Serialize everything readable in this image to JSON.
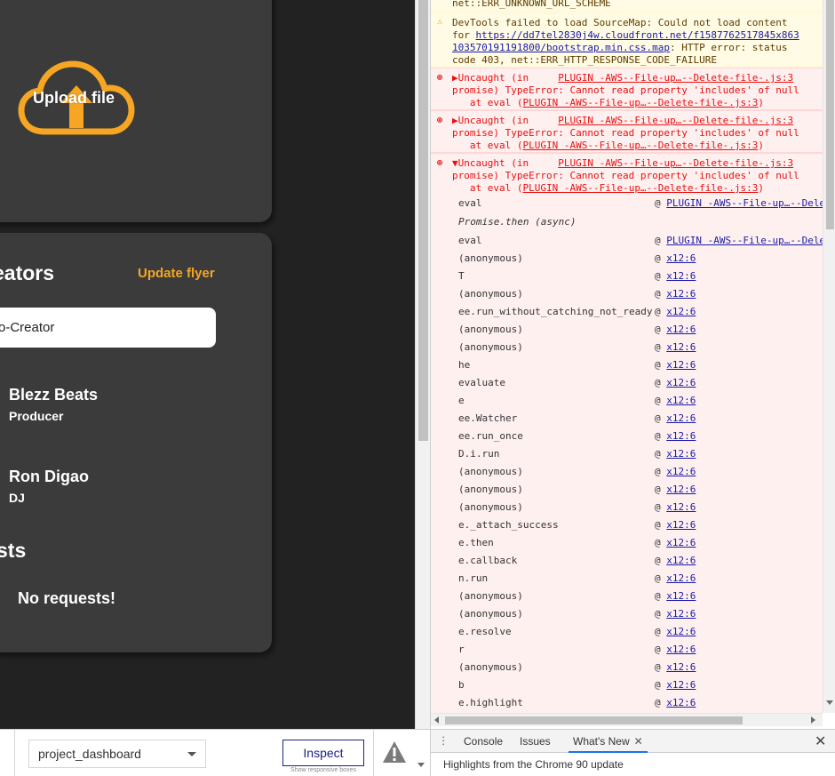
{
  "app": {
    "upload_label": "Upload file",
    "creators_title": "eators",
    "update_flyer": "Update flyer",
    "creator_input_value": "o-Creator",
    "people": [
      {
        "name": "Blezz Beats",
        "role": "Producer"
      },
      {
        "name": "Ron Digao",
        "role": "DJ"
      }
    ],
    "requests_title": "sts",
    "no_requests": "No requests!",
    "colors": {
      "accent": "#f6a623",
      "card": "#3b3b3b",
      "bg": "#222222"
    }
  },
  "device_toolbar": {
    "project_value": "project_dashboard",
    "inspect_label": "Inspect",
    "inspect_sub": "Show responsive boxes"
  },
  "console": {
    "top_line": "net::ERR_UNKNOWN_URL_SCHEME",
    "warning": {
      "line1": "DevTools failed to load SourceMap: Could not load content",
      "line2_prefix": "for ",
      "line2_link": "https://dd7tel2830j4w.cloudfront.net/f1587762517845x863",
      "line3_link": "103570191191800/bootstrap.min.css.map",
      "line3_suffix": ": HTTP error: status",
      "line4": "code 403, net::ERR_HTTP_RESPONSE_CODE_FAILURE"
    },
    "errors": [
      {
        "head": "Uncaught (in",
        "src": "PLUGIN -AWS--File-up…--Delete-file-.js:3",
        "line2": "promise) TypeError: Cannot read property 'includes' of null",
        "line3_prefix": "   at eval (",
        "line3_link": "PLUGIN -AWS--File-up…--Delete-file-.js:3",
        "line3_suffix": ")",
        "arrow": "▶"
      },
      {
        "head": "Uncaught (in",
        "src": "PLUGIN -AWS--File-up…--Delete-file-.js:3",
        "line2": "promise) TypeError: Cannot read property 'includes' of null",
        "line3_prefix": "   at eval (",
        "line3_link": "PLUGIN -AWS--File-up…--Delete-file-.js:3",
        "line3_suffix": ")",
        "arrow": "▶"
      },
      {
        "head": "Uncaught (in",
        "src": "PLUGIN -AWS--File-up…--Delete-file-.js:3",
        "line2": "promise) TypeError: Cannot read property 'includes' of null",
        "line3_prefix": "   at eval (",
        "line3_link": "PLUGIN -AWS--File-up…--Delete-file-.js:3",
        "line3_suffix": ")",
        "arrow": "▼"
      }
    ],
    "stack": [
      {
        "fn": "eval",
        "loc": "PLUGIN -AWS--File-up…--Delete"
      },
      {
        "fn": "Promise.then (async)",
        "loc": "",
        "italic": true
      },
      {
        "fn": "eval",
        "loc": "PLUGIN -AWS--File-up…--Delete"
      },
      {
        "fn": "(anonymous)",
        "loc": "x12:6"
      },
      {
        "fn": "T",
        "loc": "x12:6"
      },
      {
        "fn": "(anonymous)",
        "loc": "x12:6"
      },
      {
        "fn": "ee.run_without_catching_not_ready",
        "loc": "x12:6"
      },
      {
        "fn": "(anonymous)",
        "loc": "x12:6"
      },
      {
        "fn": "(anonymous)",
        "loc": "x12:6"
      },
      {
        "fn": "he",
        "loc": "x12:6"
      },
      {
        "fn": "evaluate",
        "loc": "x12:6"
      },
      {
        "fn": "e",
        "loc": "x12:6"
      },
      {
        "fn": "ee.Watcher",
        "loc": "x12:6"
      },
      {
        "fn": "ee.run_once",
        "loc": "x12:6"
      },
      {
        "fn": "D.i.run",
        "loc": "x12:6"
      },
      {
        "fn": "(anonymous)",
        "loc": "x12:6"
      },
      {
        "fn": "(anonymous)",
        "loc": "x12:6"
      },
      {
        "fn": "(anonymous)",
        "loc": "x12:6"
      },
      {
        "fn": "e._attach_success",
        "loc": "x12:6"
      },
      {
        "fn": "e.then",
        "loc": "x12:6"
      },
      {
        "fn": "e.callback",
        "loc": "x12:6"
      },
      {
        "fn": "n.run",
        "loc": "x12:6"
      },
      {
        "fn": "(anonymous)",
        "loc": "x12:6"
      },
      {
        "fn": "(anonymous)",
        "loc": "x12:6"
      },
      {
        "fn": "e.resolve",
        "loc": "x12:6"
      },
      {
        "fn": "r",
        "loc": "x12:6"
      },
      {
        "fn": "(anonymous)",
        "loc": "x12:6"
      },
      {
        "fn": "b",
        "loc": "x12:6"
      },
      {
        "fn": "e.highlight",
        "loc": "x12:6"
      }
    ],
    "at_symbol": "@"
  },
  "drawer": {
    "tabs": [
      {
        "label": "Console"
      },
      {
        "label": "Issues"
      },
      {
        "label": "What's New",
        "active": true,
        "close": "✕"
      }
    ],
    "close": "✕",
    "highlights": "Highlights from the Chrome 90 update"
  }
}
